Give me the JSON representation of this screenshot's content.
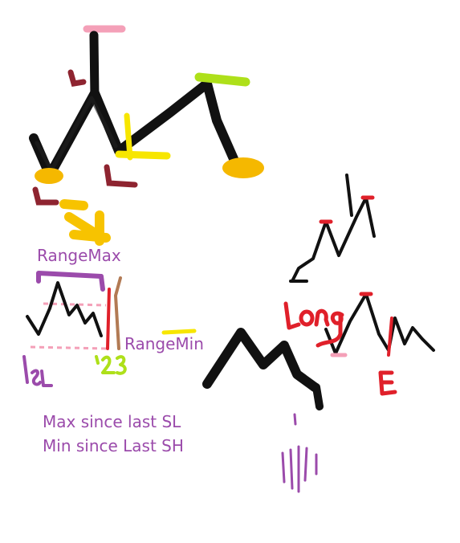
{
  "labels": {
    "range_max": "RangeMax",
    "range_min": "RangeMin",
    "note_max": "Max since last SL",
    "note_min": "Min since Last SH"
  },
  "handwriting": {
    "long": "Long",
    "e": "E",
    "sl": "SL",
    "number": "'23"
  },
  "colors": {
    "background": "#ffffff",
    "ink": "#111111",
    "purple": "#9b4bab",
    "red": "#e0202a",
    "dark_red": "#8e2430",
    "gold": "#f5b800",
    "yellow": "#f7e600",
    "lime": "#aee01a",
    "pink": "#f4a0b8",
    "brown": "#b27a54"
  }
}
